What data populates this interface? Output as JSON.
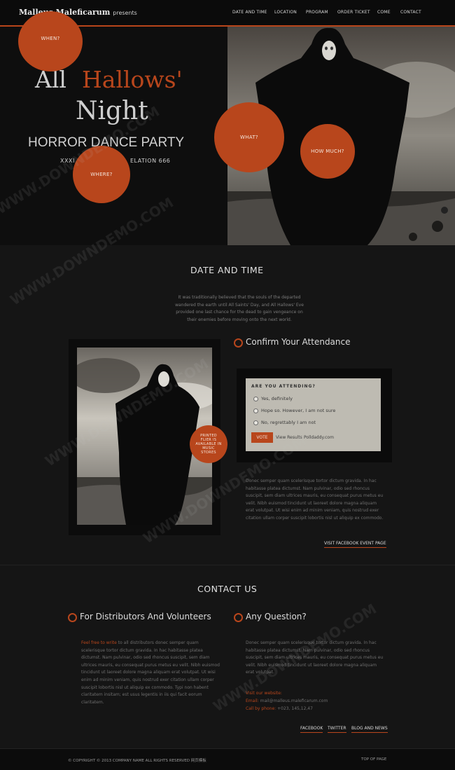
{
  "brand": {
    "name": "Malleus Maleficarum",
    "suffix": "presents"
  },
  "nav": [
    "DATE AND TIME",
    "LOCATION",
    "PROGRAM",
    "ORDER TICKET",
    "COME",
    "CONTACT"
  ],
  "hero": {
    "title_all": "All",
    "title_hallows": "Hallows'",
    "title_night": "Night",
    "subtitle": "HORROR DANCE PARTY",
    "tagline_left": "XXXI",
    "tagline_right": "ELATION 666",
    "circles": {
      "when": "WHEN?",
      "where": "WHERE?",
      "what": "WHAT?",
      "how_much": "HOW MUCH?"
    }
  },
  "date_section": {
    "title": "DATE AND TIME",
    "intro": "It was traditionally believed that the souls of the departed wandered the earth until All Saints' Day, and All Hallows' Eve provided one last chance for the dead to gain vengeance on their enemies before moving onto the next world."
  },
  "flier_badge": "PRINTED FLIER IS AVAILABLE IN MUSIC STORES",
  "attendance": {
    "heading": "Confirm Your Attendance",
    "poll_question": "ARE YOU ATTENDING?",
    "options": [
      "Yes, definitely",
      "Hope so. However, I am not sure",
      "No, regrettably I am not"
    ],
    "vote_label": "VOTE",
    "view_results": "View Results",
    "polldaddy": "Polldaddy.com",
    "body": "Donec semper quam scelerisque tortor dictum gravida. In hac habitasse platea dictumst. Nam pulvinar, odio sed rhoncus suscipit, sem diam ultrices mauris, eu consequat purus metus eu velit. Nibh euismod tincidunt ut laoreet dolore magna aliquam erat volutpat. Ut wisi enim ad minim veniam, quis nostrud exer citation ullam corper suscipit lobortis nisl ut aliquip ex commodo.",
    "fb_link": "VISIT FACEBOOK EVENT PAGE"
  },
  "contact": {
    "title": "CONTACT US",
    "left_heading": "For Distributors And Volunteers",
    "left_highlight": "Feel free to write",
    "left_body": " to all distributors donec semper quam scelerisque tortor dictum gravida. In hac habitasse platea dictumst. Nam pulvinar, odio sed rhoncus suscipit, sem diam ultrices mauris, eu consequat purus metus eu velit. Nibh euismod tincidunt ut laoreet dolore magna aliquam erat volutpat. Ut wisi enim ad minim veniam, quis nostrud exer citation ullam corper suscipit lobortis nisl ut aliquip ex commodo. Typi non habent claritatem insitam; est usus legentis in iis qui facit eorum claritatem.",
    "right_heading": "Any Question?",
    "right_body": "Donec semper quam scelerisque tortor dictum gravida. In hac habitasse platea dictumst. Nam pulvinar, odio sed rhoncus suscipit, sem diam ultrices mauris, eu consequat purus metus eu velit. Nibh euismod tincidunt ut laoreet dolore magna aliquam erat volutpat.",
    "website_label": "Visit our website:",
    "email_label": "Email:",
    "email_value": "mail@malleus.maleficarum.com",
    "phone_label": "Call by phone:",
    "phone_value": "+023, 145,12,47",
    "social": [
      "FACEBOOK",
      "TWITTER",
      "BLOG AND NEWS"
    ]
  },
  "footer": {
    "copyright": "© COPYRIGHT © 2013 COMPANY NAME ALL RIGHTS RESERVED 网页模板",
    "top": "TOP OF PAGE"
  },
  "watermark": "WWW.DOWNDEMO.COM",
  "colors": {
    "accent": "#b8461c",
    "bg": "#151515",
    "poll_bg": "#bebbb2"
  }
}
